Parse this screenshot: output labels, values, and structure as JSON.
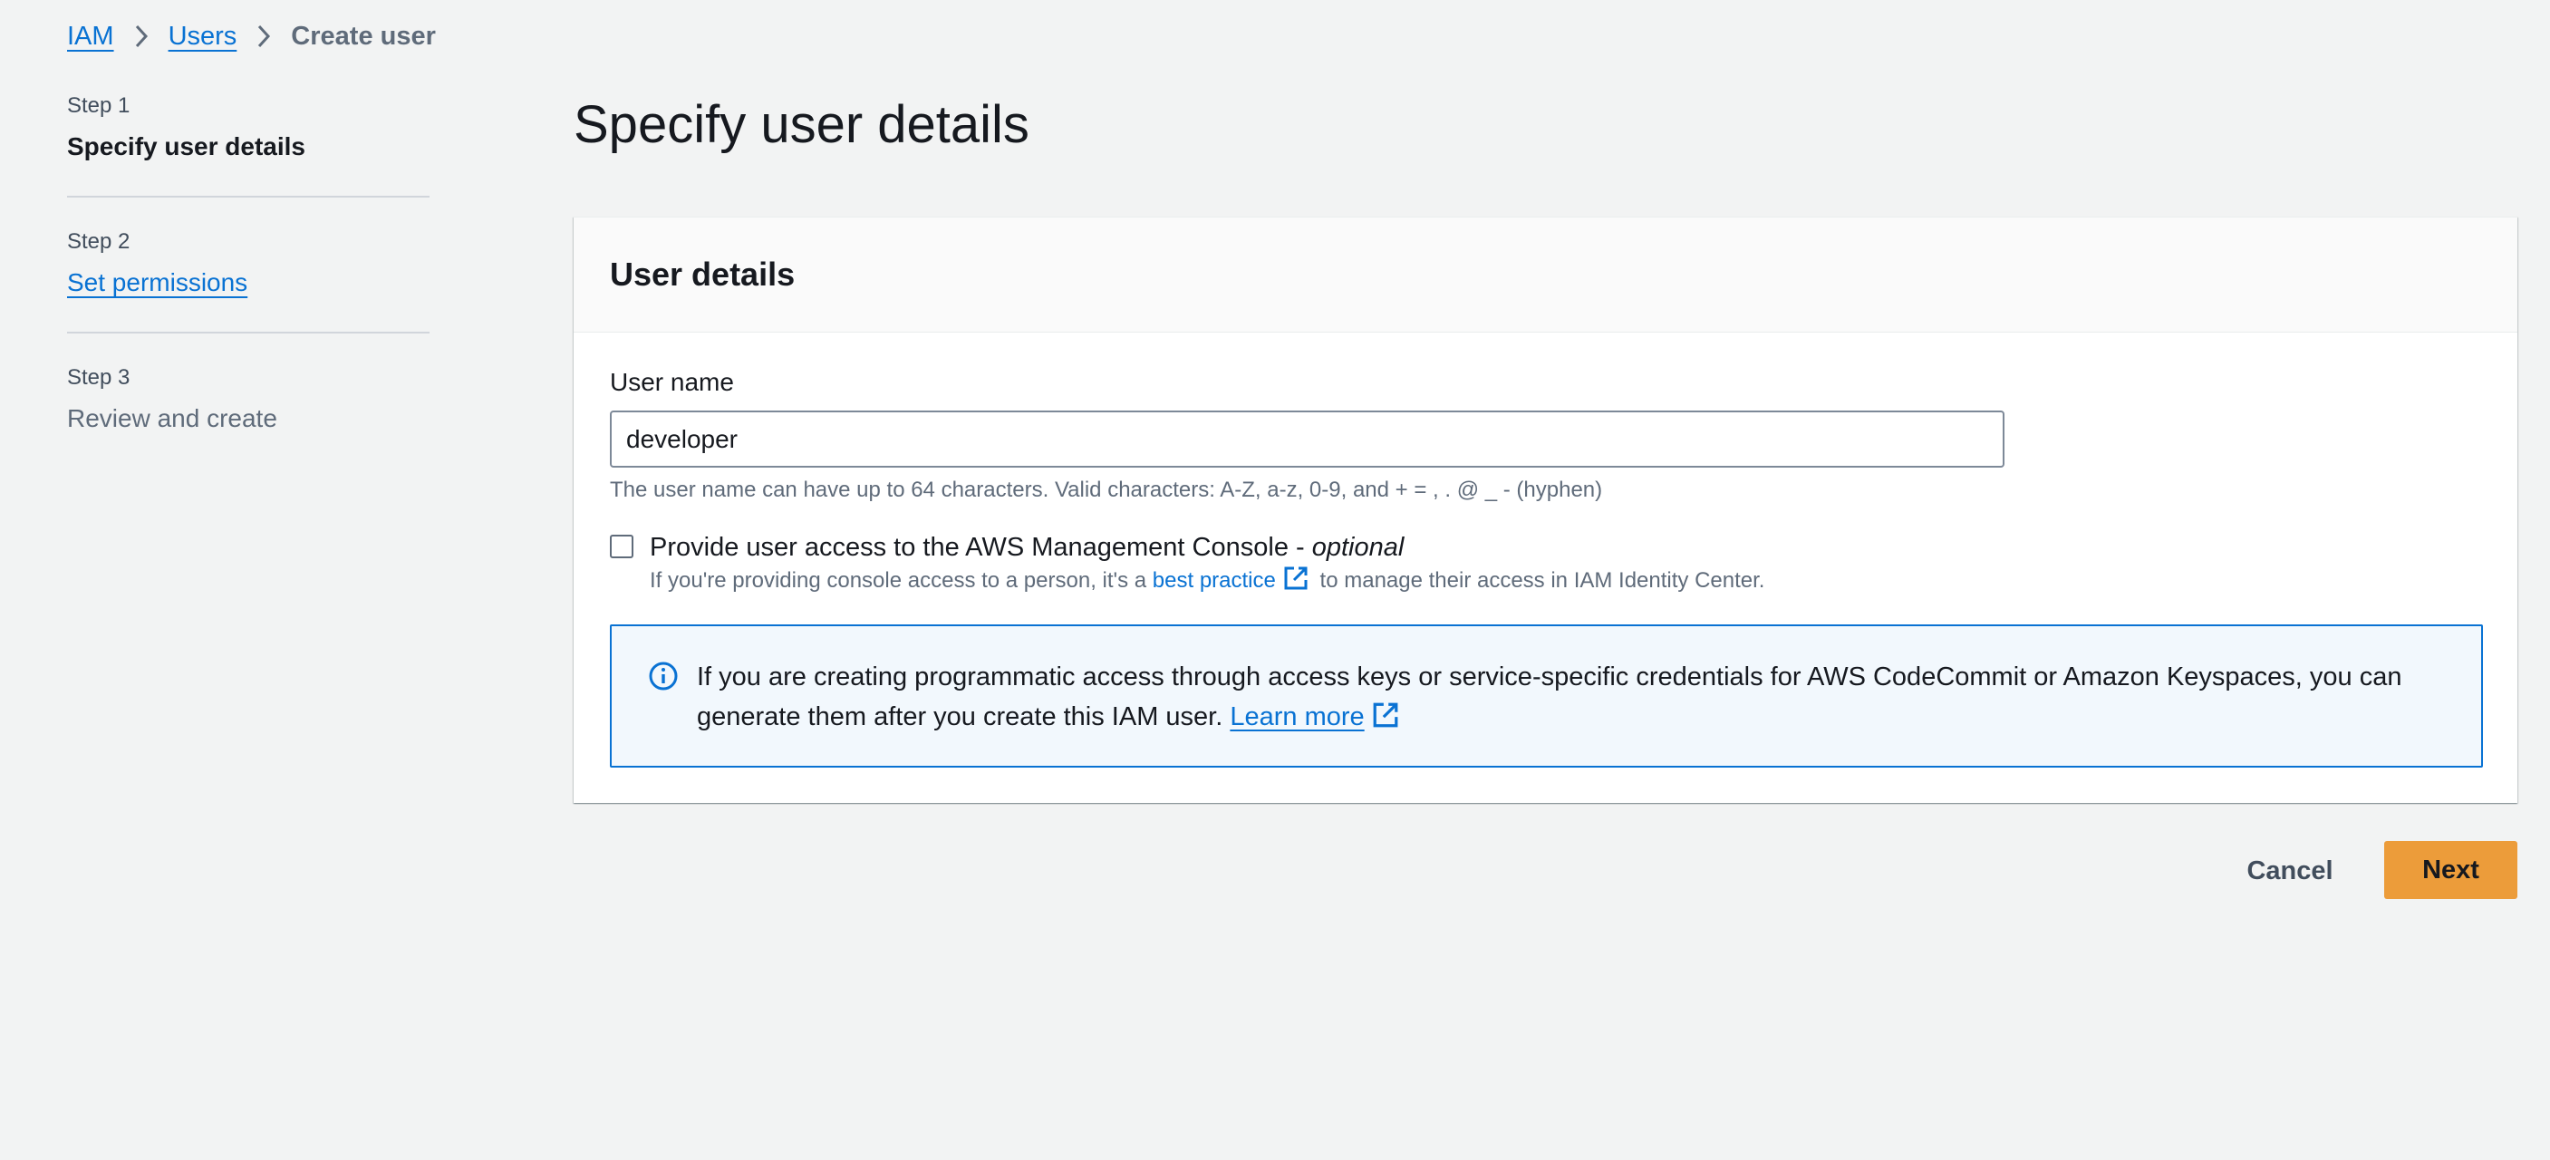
{
  "breadcrumb": {
    "items": [
      {
        "label": "IAM"
      },
      {
        "label": "Users"
      },
      {
        "label": "Create user"
      }
    ]
  },
  "steps": [
    {
      "number": "Step 1",
      "title": "Specify user details",
      "state": "active"
    },
    {
      "number": "Step 2",
      "title": "Set permissions",
      "state": "link"
    },
    {
      "number": "Step 3",
      "title": "Review and create",
      "state": "disabled"
    }
  ],
  "page": {
    "title": "Specify user details"
  },
  "user_details": {
    "header": "User details",
    "user_name_label": "User name",
    "user_name_value": "developer",
    "constraint": "The user name can have up to 64 characters. Valid characters: A-Z, a-z, 0-9, and + = , . @ _ - (hyphen)",
    "console_checkbox": {
      "checked": false,
      "label": "Provide user access to the AWS Management Console - ",
      "label_optional": "optional",
      "desc_before": "If you're providing console access to a person, it's a ",
      "desc_link": "best practice",
      "desc_after": " to manage their access in IAM Identity Center."
    },
    "info_alert": {
      "text": "If you are creating programmatic access through access keys or service-specific credentials for AWS CodeCommit or Amazon Keyspaces, you can generate them after you create this IAM user. ",
      "link": "Learn more"
    }
  },
  "footer": {
    "cancel_label": "Cancel",
    "next_label": "Next"
  },
  "colors": {
    "background": "#f2f3f3",
    "link": "#0972d3",
    "primary_button": "#ec9c3a",
    "info_border": "#0972d3",
    "info_background": "#f2f8fd"
  },
  "icons": {
    "breadcrumb_separator": "chevron-right-icon",
    "external_link": "external-link-icon",
    "info": "info-icon"
  }
}
